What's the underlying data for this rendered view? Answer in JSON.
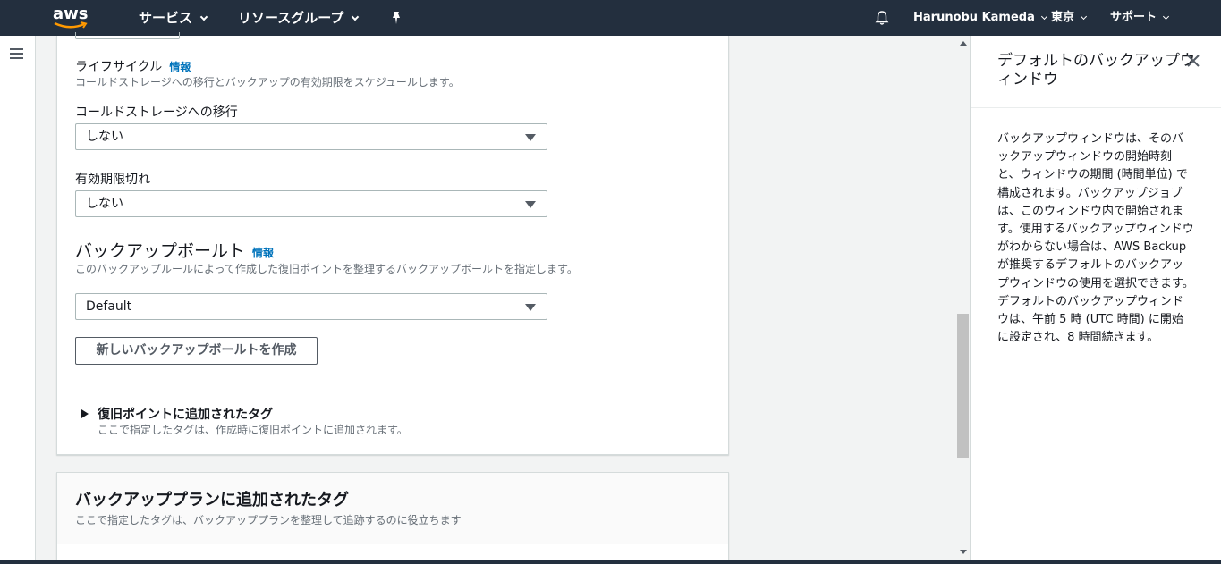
{
  "nav": {
    "logo": "aws",
    "services": "サービス",
    "resource_groups": "リソースグループ",
    "pin_icon": "pin-icon",
    "bell_icon": "bell-icon",
    "user": "Harunobu Kameda",
    "region": "東京",
    "support": "サポート"
  },
  "form": {
    "lifecycle_label": "ライフサイクル",
    "lifecycle_info": "情報",
    "lifecycle_desc": "コールドストレージへの移行とバックアップの有効期限をスケジュールします。",
    "cold_label": "コールドストレージへの移行",
    "cold_value": "しない",
    "expire_label": "有効期限切れ",
    "expire_value": "しない",
    "vault_heading": "バックアップボールト",
    "vault_info": "情報",
    "vault_desc": "このバックアップルールによって作成した復旧ポイントを整理するバックアップボールトを指定します。",
    "vault_value": "Default",
    "create_vault_button": "新しいバックアップボールトを作成",
    "recovery_tags_title": "復旧ポイントに追加されたタグ",
    "recovery_tags_desc": "ここで指定したタグは、作成時に復旧ポイントに追加されます。"
  },
  "plan_tags": {
    "title": "バックアッププランに追加されたタグ",
    "desc": "ここで指定したタグは、バックアッププランを整理して追跡するのに役立ちます"
  },
  "help": {
    "title": "デフォルトのバックアップウィンドウ",
    "body": "バックアップウィンドウは、そのバックアップウィンドウの開始時刻と、ウィンドウの期間 (時間単位) で構成されます。バックアップジョブは、このウィンドウ内で開始されます。使用するバックアップウィンドウがわからない場合は、AWS Backup が推奨するデフォルトのバックアップウィンドウの使用を選択できます。デフォルトのバックアップウィンドウは、午前 5 時 (UTC 時間) に開始に設定され、8 時間続きます。"
  },
  "colors": {
    "nav_bg": "#232f3e",
    "link": "#0073bb",
    "page_bg": "#f2f3f3"
  }
}
